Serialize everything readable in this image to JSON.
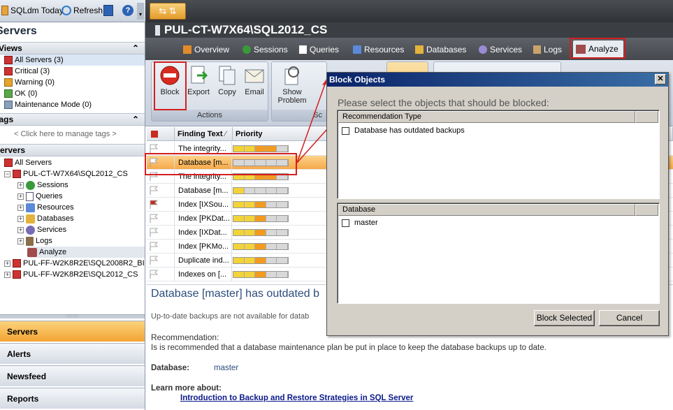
{
  "toolbar": {
    "sqldm_today": "SQLdm Today",
    "refresh": "Refresh"
  },
  "left_panel": {
    "servers_header": "Servers",
    "views_header": "Views",
    "views": [
      "All Servers (3)",
      "Critical (3)",
      "Warning (0)",
      "OK (0)",
      "Maintenance Mode (0)"
    ],
    "tags_header": "Tags",
    "manage_tags": "< Click here to manage tags >",
    "servers_tree_header": "Servers",
    "tree": {
      "all_servers": "All Servers",
      "server1": "PUL-CT-W7X64\\SQL2012_CS",
      "children": [
        "Sessions",
        "Queries",
        "Resources",
        "Databases",
        "Services",
        "Logs",
        "Analyze"
      ],
      "server2": "PUL-FF-W2K8R2E\\SQL2008R2_BI",
      "server3": "PUL-FF-W2K8R2E\\SQL2012_CS"
    },
    "nav": [
      "Servers",
      "Alerts",
      "Newsfeed",
      "Reports"
    ]
  },
  "main": {
    "title": "PUL-CT-W7X64\\SQL2012_CS",
    "tabs": [
      "Overview",
      "Sessions",
      "Queries",
      "Resources",
      "Databases",
      "Services",
      "Logs",
      "Analyze"
    ],
    "ribbon": {
      "block": "Block",
      "export": "Export",
      "copy": "Copy",
      "email": "Email",
      "actions_label": "Actions",
      "show_problem": "Show Problem",
      "script_label_partial": "Sc"
    },
    "grid": {
      "col_finding": "Finding Text",
      "col_priority": "Priority",
      "rows": [
        {
          "text": "The integrity...",
          "prio": 4,
          "flag": "none"
        },
        {
          "text": "Database [m...",
          "prio": 0,
          "flag": "none",
          "selected": true
        },
        {
          "text": "The integrity...",
          "prio": 4,
          "flag": "none"
        },
        {
          "text": "Database [m...",
          "prio": 1,
          "flag": "none"
        },
        {
          "text": "Index [IXSou...",
          "prio": 3,
          "flag": "red"
        },
        {
          "text": "Index [PKDat...",
          "prio": 3,
          "flag": "none"
        },
        {
          "text": "Index [IXDat...",
          "prio": 3,
          "flag": "none"
        },
        {
          "text": "Index [PKMo...",
          "prio": 3,
          "flag": "none"
        },
        {
          "text": "Duplicate ind...",
          "prio": 3,
          "flag": "none"
        },
        {
          "text": "Indexes on [...",
          "prio": 3,
          "flag": "none"
        }
      ]
    },
    "detail": {
      "heading": "Database [master] has outdated b",
      "summary": "Up-to-date backups are not available for datab",
      "recommendation_label": "Recommendation:",
      "recommendation_text": "Is is recommended that a database maintenance plan be put in place to keep the database backups up to date.",
      "database_label": "Database:",
      "database_value": "master",
      "learn_more_label": "Learn more about:",
      "learn_more_link": "Introduction to Backup and Restore Strategies in SQL Server"
    }
  },
  "dialog": {
    "title": "Block Objects",
    "close": "✕",
    "instruction": "Please select the objects that should be blocked:",
    "list1_header": "Recommendation Type",
    "list1_items": [
      "Database has outdated backups"
    ],
    "list2_header": "Database",
    "list2_items": [
      "master"
    ],
    "block_selected": "Block Selected",
    "cancel": "Cancel"
  },
  "colors": {
    "selected_row": "#f6a94a",
    "annotation_red": "#d41f1f",
    "priority_orange": "#f39b1f",
    "priority_yellow": "#f2d33a"
  }
}
